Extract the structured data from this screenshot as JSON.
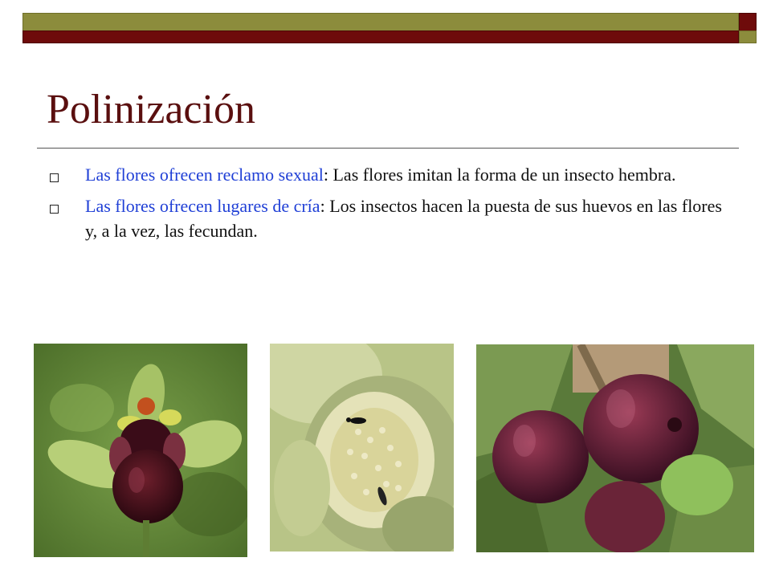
{
  "slide": {
    "title": "Polinización",
    "bullets": [
      {
        "lead": "Las flores ofrecen reclamo sexual",
        "sep": ":",
        "rest": " Las flores imitan la forma de un insecto hembra."
      },
      {
        "lead": "Las flores ofrecen lugares de cría",
        "sep": ":",
        "rest": " Los insectos hacen la puesta de sus huevos en las flores y, a la vez, las fecundan."
      }
    ]
  },
  "colors": {
    "title": "#5a0f0f",
    "accent_blue": "#1f3fd6",
    "bar_olive": "#8c8c3c",
    "bar_red": "#6e0b0b"
  },
  "icons": [
    "square-bullet-icon"
  ]
}
